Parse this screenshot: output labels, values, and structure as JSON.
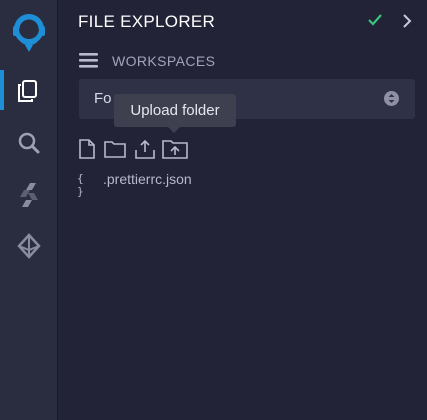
{
  "sidebar": {
    "icons": [
      "remix-logo-icon",
      "file-explorer-icon",
      "search-icon",
      "solidity-compiler-icon",
      "deploy-run-icon"
    ],
    "accent": "#1e8ed6"
  },
  "panel": {
    "title": "FILE EXPLORER",
    "workspaces_label": "WORKSPACES",
    "workspace_select_value": "Fo",
    "tooltip": "Upload folder",
    "toolbar_icons": [
      "new-file-icon",
      "new-folder-icon",
      "upload-file-icon",
      "upload-folder-icon"
    ],
    "files": [
      {
        "name": ".prettierrc.json",
        "icon": "json-file-icon"
      }
    ],
    "check_color": "#3dc37a"
  }
}
